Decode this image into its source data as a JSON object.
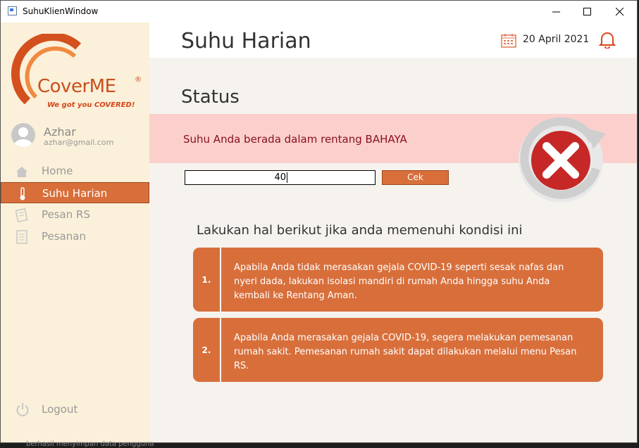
{
  "window": {
    "title": "SuhuKlienWindow",
    "controls": {
      "minimize": "—",
      "maximize": "☐",
      "close": "✕"
    }
  },
  "sidebar": {
    "brand": {
      "name": "CoverME",
      "registered": "®",
      "tagline": "We got you COVERED!"
    },
    "user": {
      "name": "Azhar",
      "email": "azhar@gmail.com"
    },
    "items": [
      {
        "label": "Home",
        "icon": "home-icon",
        "active": false
      },
      {
        "label": "Suhu Harian",
        "icon": "thermometer-icon",
        "active": true
      },
      {
        "label": "Pesan RS",
        "icon": "note-icon",
        "active": false
      },
      {
        "label": "Pesanan",
        "icon": "document-icon",
        "active": false
      }
    ],
    "logout_label": "Logout"
  },
  "header": {
    "title": "Suhu Harian",
    "date": "20 April 2021"
  },
  "status": {
    "heading": "Status",
    "message": "Suhu Anda berada dalam rentang BAHAYA",
    "state_icon": "danger-x-icon"
  },
  "form": {
    "temperature_value": "40",
    "check_label": "Cek"
  },
  "instructions": {
    "heading": "Lakukan hal berikut jika anda memenuhi kondisi ini",
    "items": [
      {
        "number": "1.",
        "text": "Apabila Anda tidak merasakan gejala COVID-19 seperti sesak nafas dan nyeri dada, lakukan isolasi mandiri di rumah Anda hingga suhu Anda kembali ke Rentang Aman."
      },
      {
        "number": "2.",
        "text": "Apabila Anda merasakan gejala COVID-19, segera melakukan pemesanan rumah sakit. Pemesanan rumah sakit dapat dilakukan melalui menu Pesan RS."
      }
    ]
  },
  "colors": {
    "accent": "#d86f3b",
    "sidebar_bg": "#fbf0d9",
    "danger_banner": "#fbd0cc",
    "danger_text": "#8a1020",
    "danger_icon": "#c62828"
  },
  "background_text": "berhasil menyimpan data pengguna"
}
